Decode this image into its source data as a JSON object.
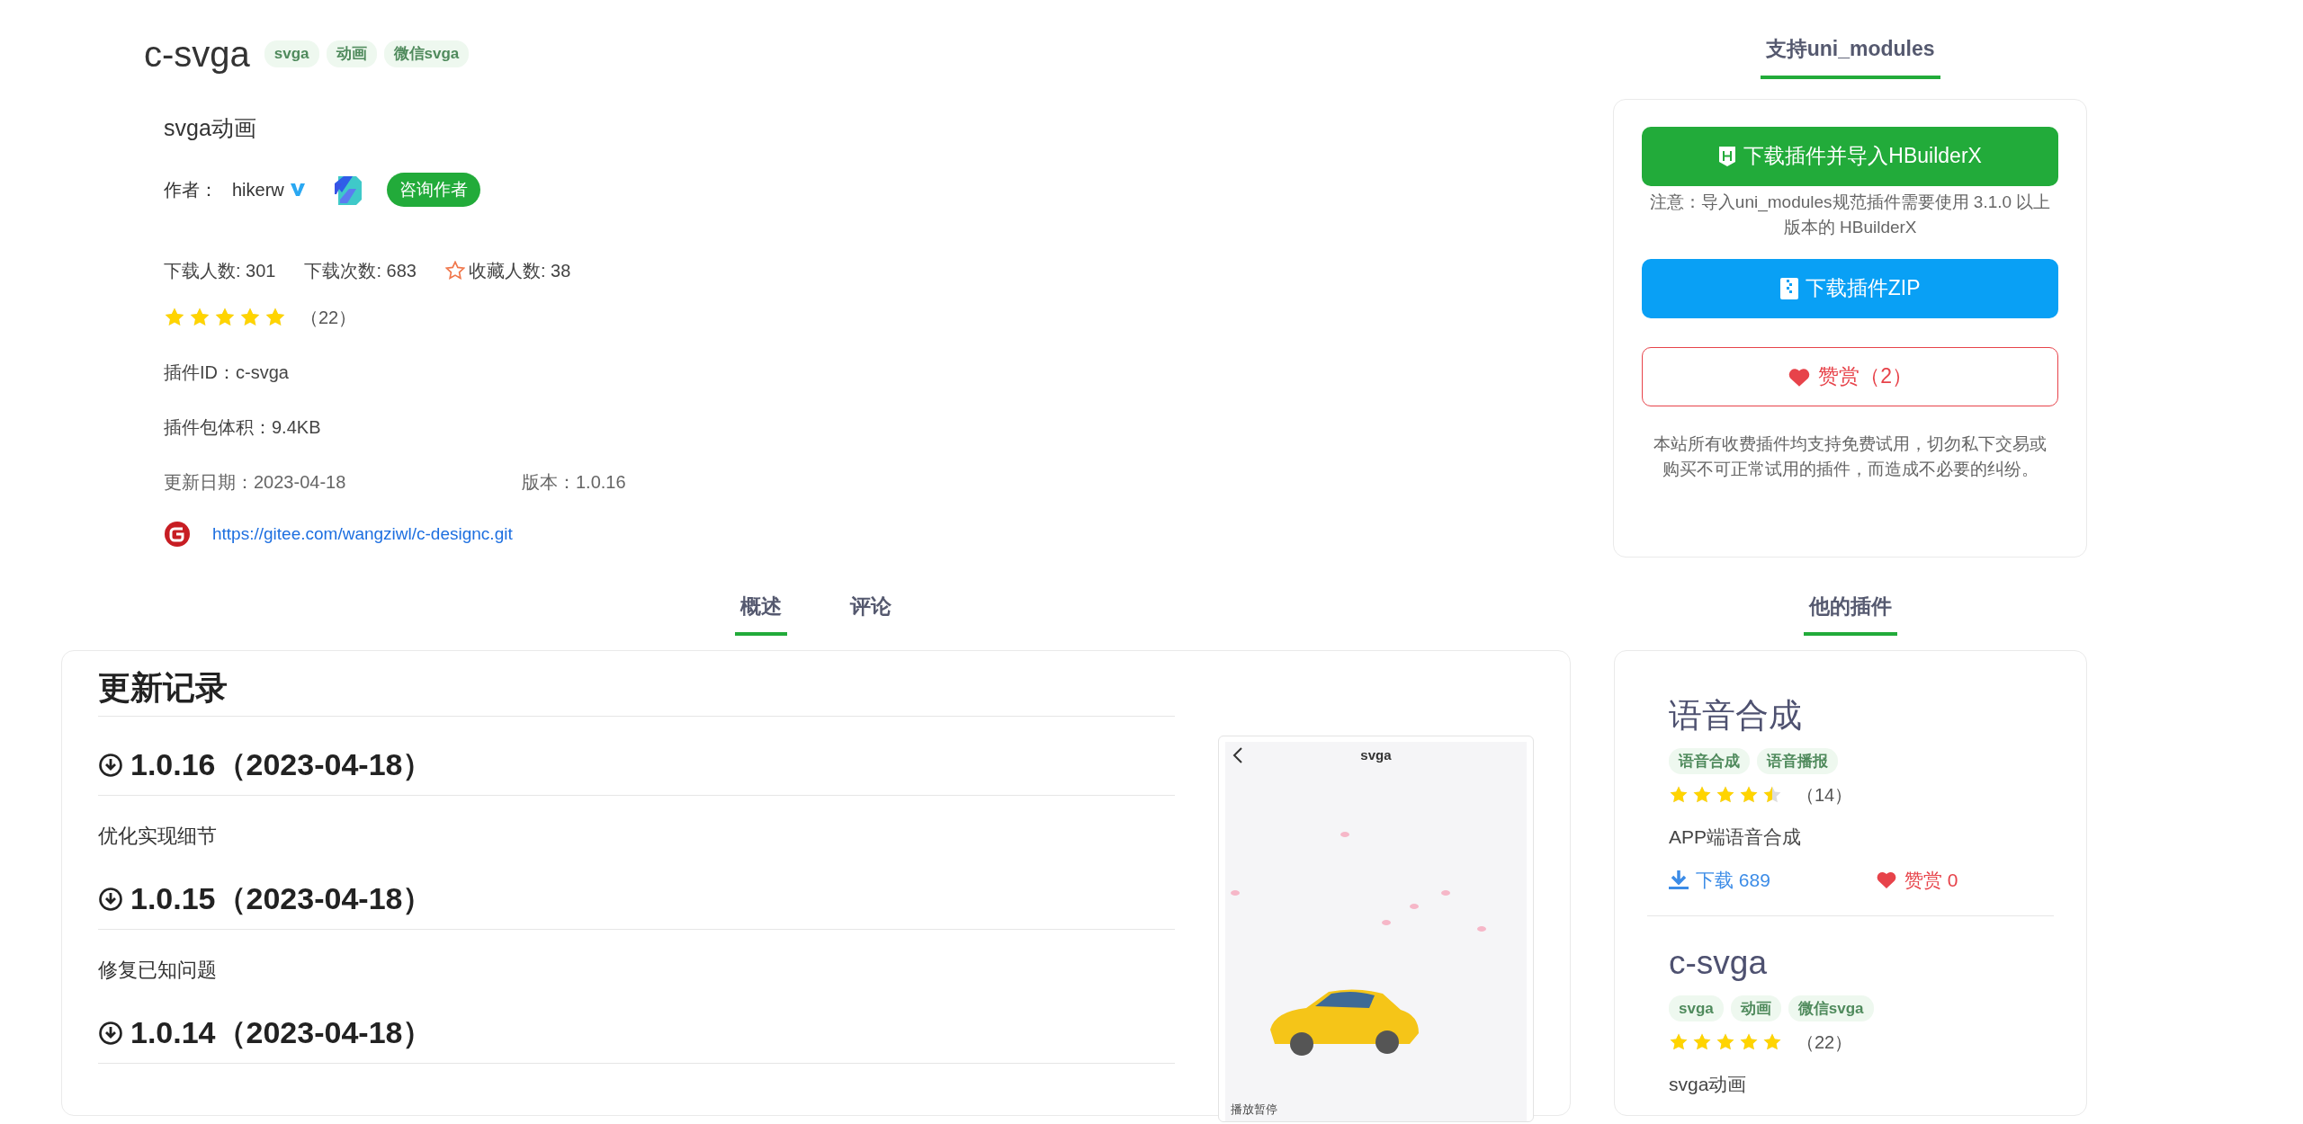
{
  "plugin": {
    "title": "c-svga",
    "tags": [
      "svga",
      "动画",
      "微信svga"
    ],
    "subtitle": "svga动画",
    "author_label": "作者：",
    "author": "hikerw",
    "verified": true,
    "consult_button": "咨询作者",
    "stats": [
      {
        "kind": "plain",
        "text": "下载人数: 301"
      },
      {
        "kind": "plain",
        "text": "下载次数: 683"
      },
      {
        "kind": "favorite",
        "text": "收藏人数: 38"
      }
    ],
    "stars": 5,
    "rating_count": "（22）",
    "plugin_id": "插件ID：c-svga",
    "size": "插件包体积：9.4KB",
    "updated": "更新日期：2023-04-18",
    "version": "版本：1.0.16",
    "repo_link": "https://gitee.com/wangziwl/c-designc.git"
  },
  "side_tab": {
    "label": "支持uni_modules",
    "selected": true
  },
  "download_panel": {
    "import_button": "下载插件并导入HBuilderX",
    "note": "注意：导入uni_modules规范插件需要使用 3.1.0 以上版本的 HBuilderX",
    "zip_button": "下载插件ZIP",
    "reward_button": "赞赏（2）",
    "disclaimer": "本站所有收费插件均支持免费试用，切勿私下交易或购买不可正常试用的插件，而造成不必要的纠纷。"
  },
  "tabs": [
    {
      "label": "概述",
      "selected": true
    },
    {
      "label": "评论",
      "selected": false
    }
  ],
  "changelog": {
    "heading": "更新记录",
    "entries": [
      {
        "version": "1.0.16（2023-04-18）",
        "note": "优化实现细节"
      },
      {
        "version": "1.0.15（2023-04-18）",
        "note": "修复已知问题"
      },
      {
        "version": "1.0.14（2023-04-18）"
      }
    ]
  },
  "preview": {
    "title": "svga",
    "caption": "播放暂停"
  },
  "other_tab": {
    "label": "他的插件",
    "selected": true
  },
  "other_plugins": [
    {
      "title": "语音合成",
      "tags": [
        "语音合成",
        "语音播报"
      ],
      "stars": 4.5,
      "rating_count": "（14）",
      "description": "APP端语音合成",
      "downloads": "下载 689",
      "reward": "赞赏 0"
    },
    {
      "title": "c-svga",
      "tags": [
        "svga",
        "动画",
        "微信svga"
      ],
      "stars": 5,
      "rating_count": "（22）",
      "description": "svga动画"
    }
  ]
}
